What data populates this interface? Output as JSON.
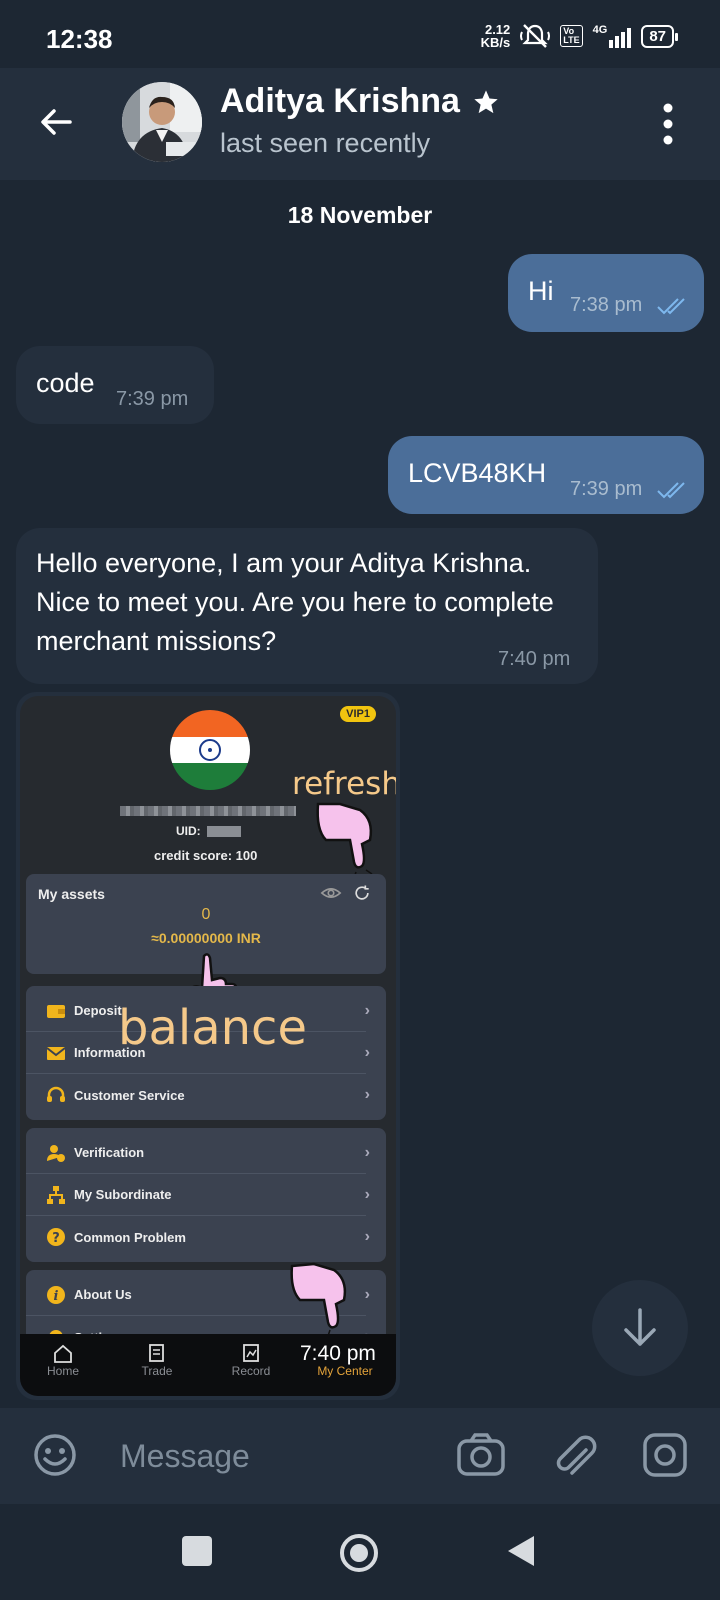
{
  "status_bar": {
    "time": "12:38",
    "net_speed_value": "2.12",
    "net_speed_unit": "KB/s",
    "volte_label": "Vo\nLTE",
    "network_label": "4G",
    "battery": "87"
  },
  "header": {
    "contact_name": "Aditya Krishna",
    "status": "last seen recently"
  },
  "chat": {
    "date_separator": "18 November",
    "messages": [
      {
        "direction": "out",
        "text": "Hi",
        "time": "7:38 pm"
      },
      {
        "direction": "in",
        "text": "code",
        "time": "7:39 pm"
      },
      {
        "direction": "out",
        "text": "LCVB48KH",
        "time": "7:39 pm"
      },
      {
        "direction": "in",
        "text": "Hello everyone, I am your Aditya Krishna. Nice to meet you. Are you here to complete merchant missions?",
        "time": "7:40 pm"
      }
    ],
    "image_message": {
      "time": "7:40 pm",
      "vip_badge": "VIP1",
      "uid_label": "UID:",
      "credit_score": "credit score: 100",
      "annotation_refresh": "refresh",
      "annotation_balance": "balance",
      "assets": {
        "title": "My assets",
        "value": "0",
        "inr": "≈0.00000000 INR"
      },
      "menu_group_1": [
        "Deposit",
        "Information",
        "Customer Service"
      ],
      "menu_group_2": [
        "Verification",
        "My Subordinate",
        "Common Problem"
      ],
      "menu_group_3": [
        "About Us",
        "Setting"
      ],
      "bottom_nav": [
        "Home",
        "Trade",
        "Record",
        "My Center"
      ]
    }
  },
  "composer": {
    "placeholder": "Message"
  }
}
